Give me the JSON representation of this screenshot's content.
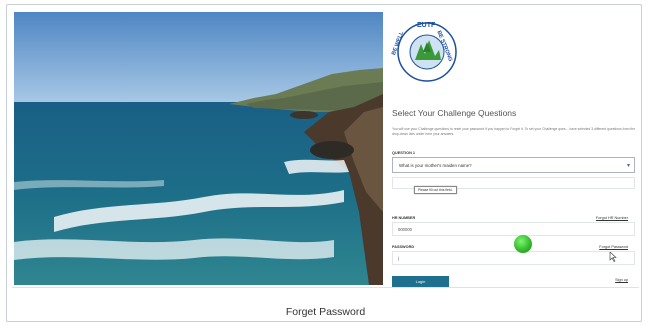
{
  "logo": {
    "top_text": "EUTF",
    "left_text": "BE WELL",
    "right_text": "BE STRONG"
  },
  "panel": {
    "title": "Select Your Challenge Questions",
    "intro": "You will use your Challenge questions to reset your password if you happen to Forget it. To set your Challenge ques... have selected 3 different questions from the drop-down lists under here your answers.",
    "question_label": "QUESTION 1",
    "question_value": "What is your mother's maiden name?",
    "tooltip": "Please fill out this field.",
    "hr_label": "HR NUMBER",
    "hr_value": "000000",
    "hr_link": "Forgot HR Number",
    "password_label": "PASSWORD",
    "password_value": "|",
    "password_link": "Forgot Password",
    "login_label": "Login",
    "signup_label": "Sign up"
  },
  "caption": "Forget Password",
  "colors": {
    "button": "#1f6f8f",
    "logo_ring": "#1b4fa0",
    "logo_tree": "#3a9a3a",
    "cursor": "#2fb62b"
  }
}
